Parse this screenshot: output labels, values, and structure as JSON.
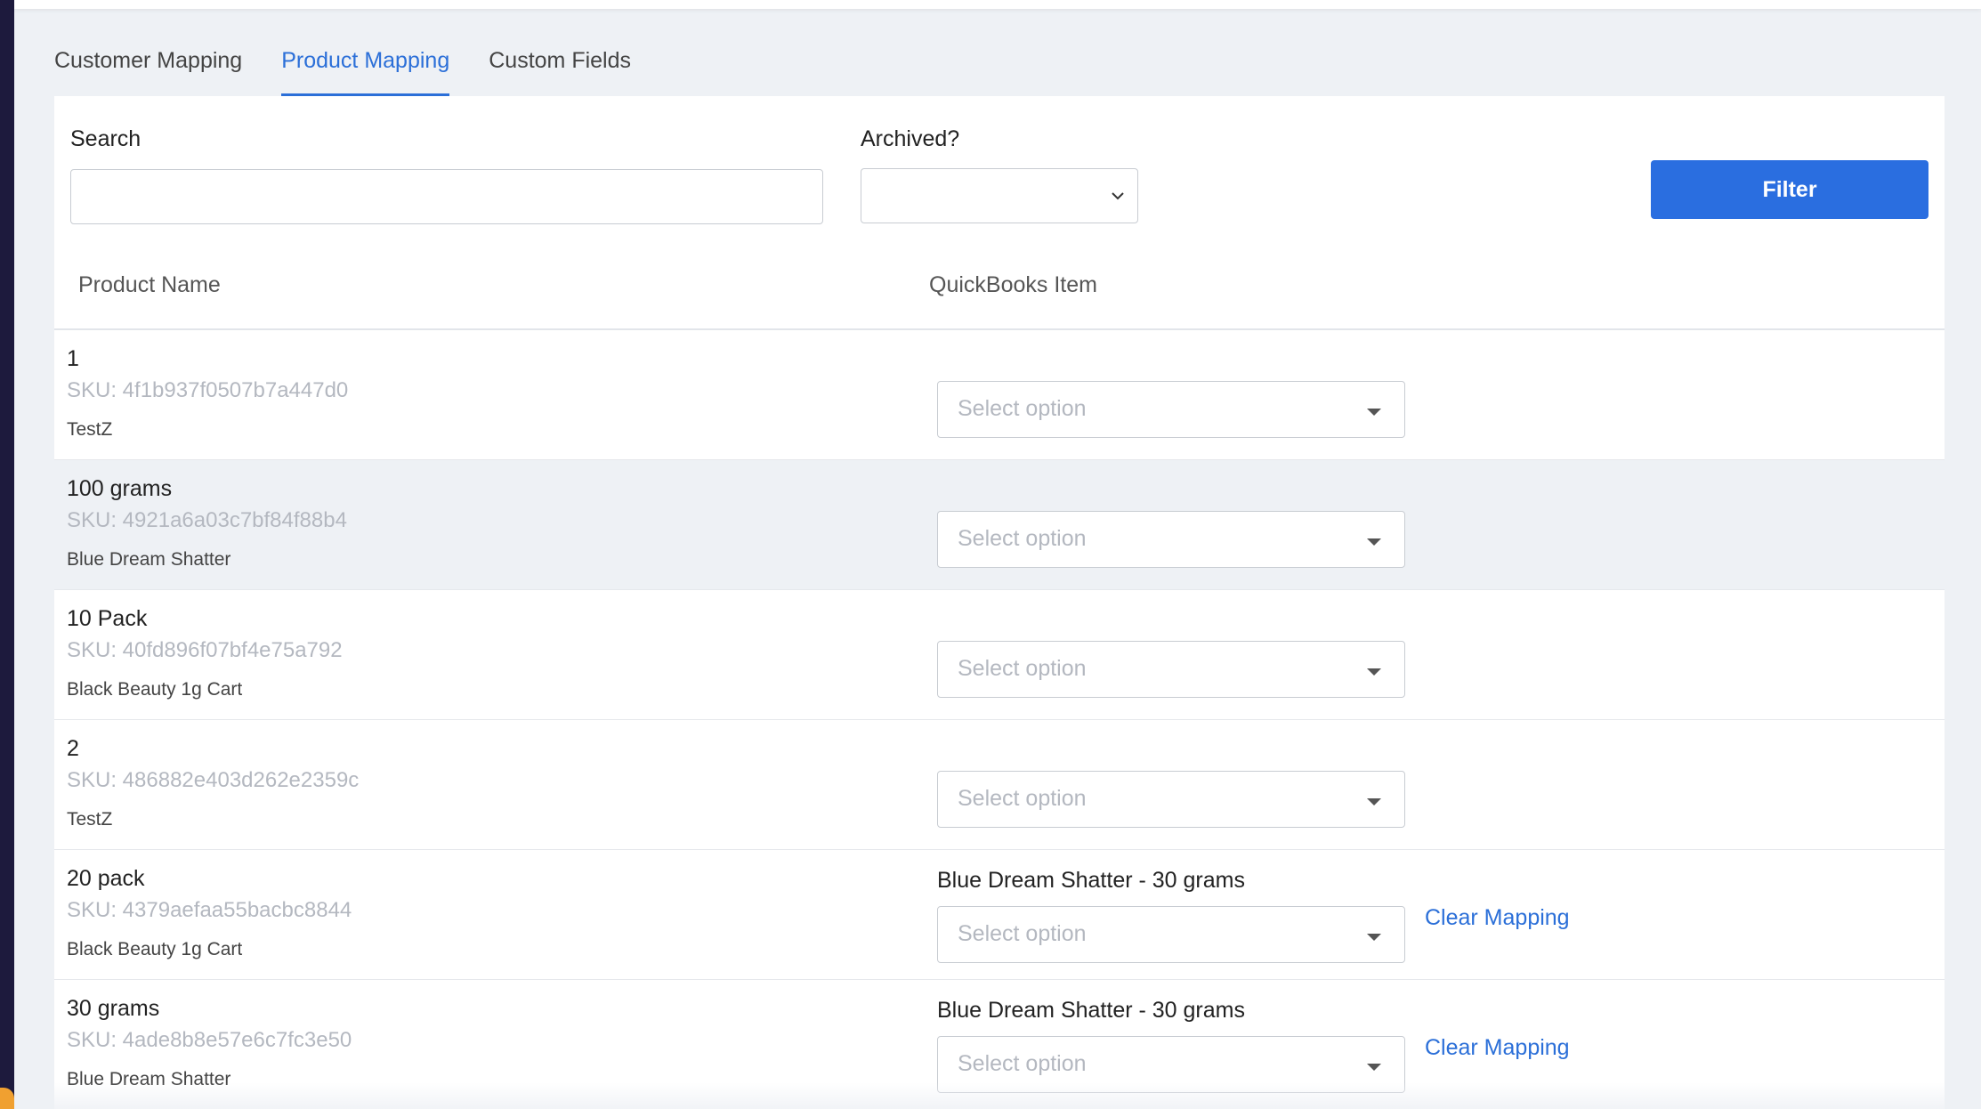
{
  "tabs": [
    {
      "label": "Customer Mapping",
      "active": false
    },
    {
      "label": "Product Mapping",
      "active": true
    },
    {
      "label": "Custom Fields",
      "active": false
    }
  ],
  "filters": {
    "search_label": "Search",
    "search_value": "",
    "archived_label": "Archived?",
    "archived_value": "",
    "filter_button": "Filter"
  },
  "table": {
    "columns": [
      "Product Name",
      "QuickBooks Item"
    ],
    "select_placeholder": "Select option",
    "clear_label": "Clear Mapping",
    "rows": [
      {
        "name": "1",
        "sku": "SKU: 4f1b937f0507b7a447d0",
        "category": "TestZ",
        "mapped": ""
      },
      {
        "name": "100 grams",
        "sku": "SKU: 4921a6a03c7bf84f88b4",
        "category": "Blue Dream Shatter",
        "mapped": ""
      },
      {
        "name": "10 Pack",
        "sku": "SKU: 40fd896f07bf4e75a792",
        "category": "Black Beauty 1g Cart",
        "mapped": ""
      },
      {
        "name": "2",
        "sku": "SKU: 486882e403d262e2359c",
        "category": "TestZ",
        "mapped": ""
      },
      {
        "name": "20 pack",
        "sku": "SKU: 4379aefaa55bacbc8844",
        "category": "Black Beauty 1g Cart",
        "mapped": "Blue Dream Shatter - 30 grams"
      },
      {
        "name": "30 grams",
        "sku": "SKU: 4ade8b8e57e6c7fc3e50",
        "category": "Blue Dream Shatter",
        "mapped": "Blue Dream Shatter - 30 grams"
      }
    ]
  },
  "colors": {
    "accent": "#2b6fd8",
    "button": "#2a6ee0",
    "sidebar": "#1d1a3d",
    "page_bg": "#eef1f5"
  }
}
